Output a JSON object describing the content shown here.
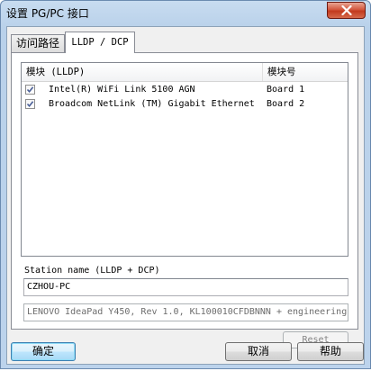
{
  "window": {
    "title": "设置 PG/PC 接口"
  },
  "tabs": [
    {
      "label": "访问路径"
    },
    {
      "label": "LLDP / DCP"
    }
  ],
  "list": {
    "columns": [
      "模块 (LLDP)",
      "模块号"
    ],
    "rows": [
      {
        "checked": true,
        "module": "Intel(R) WiFi Link 5100 AGN",
        "board": "Board 1"
      },
      {
        "checked": true,
        "module": "Broadcom NetLink (TM) Gigabit Ethernet",
        "board": "Board 2"
      }
    ]
  },
  "station": {
    "label": "Station name (LLDP + DCP)",
    "value": "CZHOU-PC"
  },
  "device_info": "LENOVO IdeaPad Y450, Rev 1.0, KL100010CFDBNNN + engineering",
  "buttons": {
    "reset": "Reset",
    "ok": "确定",
    "cancel": "取消",
    "help": "帮助"
  },
  "icons": {
    "close": "close-icon",
    "checkbox": "checkmark-icon"
  },
  "colors": {
    "titlebar": "#b9d1ea",
    "close": "#c23a1e",
    "default_button_border": "#3c7fb1"
  }
}
